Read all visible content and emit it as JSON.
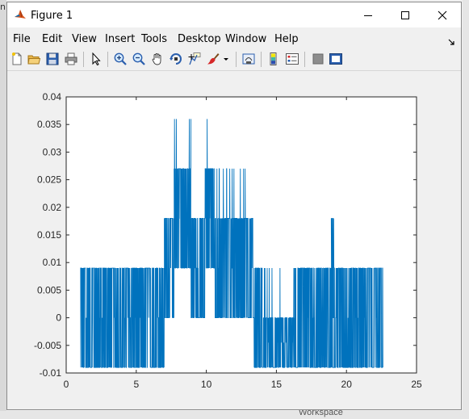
{
  "desktop": {
    "left_text": "n",
    "bottom_text": "Workspace"
  },
  "window": {
    "title": "Figure 1"
  },
  "menu": [
    "File",
    "Edit",
    "View",
    "Insert",
    "Tools",
    "Desktop",
    "Window",
    "Help"
  ],
  "toolbar": {
    "icons": [
      "new-figure-icon",
      "open-file-icon",
      "save-icon",
      "print-icon",
      "edit-plot-arrow-icon",
      "zoom-in-icon",
      "zoom-out-icon",
      "pan-hand-icon",
      "rotate-3d-icon",
      "data-cursor-icon",
      "brush-icon",
      "brush-dropdown-icon",
      "link-plot-icon",
      "insert-colorbar-icon",
      "insert-legend-icon",
      "hide-plot-tools-icon",
      "show-plot-tools-icon"
    ]
  },
  "colors": {
    "series": "#0072bd",
    "axes_bg": "#ffffff",
    "window_bg": "#f0f0f0"
  },
  "chart_data": {
    "type": "line",
    "title": "",
    "xlabel": "",
    "ylabel": "",
    "xlim": [
      0,
      25
    ],
    "ylim": [
      -0.01,
      0.04
    ],
    "xticks": [
      "0",
      "5",
      "10",
      "15",
      "20",
      "25"
    ],
    "yticks": [
      "-0.01",
      "-0.005",
      "0",
      "0.005",
      "0.01",
      "0.015",
      "0.02",
      "0.025",
      "0.03",
      "0.035",
      "0.04"
    ],
    "grid": false,
    "levels": [
      -0.009,
      0,
      0.009,
      0.018,
      0.027,
      0.036
    ],
    "segments": [
      {
        "x0": 1.0,
        "x1": 7.0,
        "low": -0.009,
        "high": 0.009,
        "peak": 0.009
      },
      {
        "x0": 7.0,
        "x1": 7.7,
        "low": 0.0,
        "high": 0.018,
        "peak": 0.018
      },
      {
        "x0": 7.7,
        "x1": 8.9,
        "low": 0.009,
        "high": 0.027,
        "peak": 0.036
      },
      {
        "x0": 8.9,
        "x1": 9.9,
        "low": 0.0,
        "high": 0.018,
        "peak": 0.018
      },
      {
        "x0": 9.9,
        "x1": 10.6,
        "low": 0.009,
        "high": 0.027,
        "peak": 0.036
      },
      {
        "x0": 10.6,
        "x1": 13.4,
        "low": 0.0,
        "high": 0.018,
        "peak": 0.027
      },
      {
        "x0": 13.4,
        "x1": 14.0,
        "low": -0.009,
        "high": 0.009,
        "peak": 0.009
      },
      {
        "x0": 14.0,
        "x1": 16.3,
        "low": -0.009,
        "high": 0.0,
        "peak": 0.009
      },
      {
        "x0": 16.3,
        "x1": 22.6,
        "low": -0.009,
        "high": 0.009,
        "peak": 0.009
      },
      {
        "x0": 18.9,
        "x1": 19.1,
        "low": 0.0,
        "high": 0.018,
        "peak": 0.018
      }
    ]
  }
}
